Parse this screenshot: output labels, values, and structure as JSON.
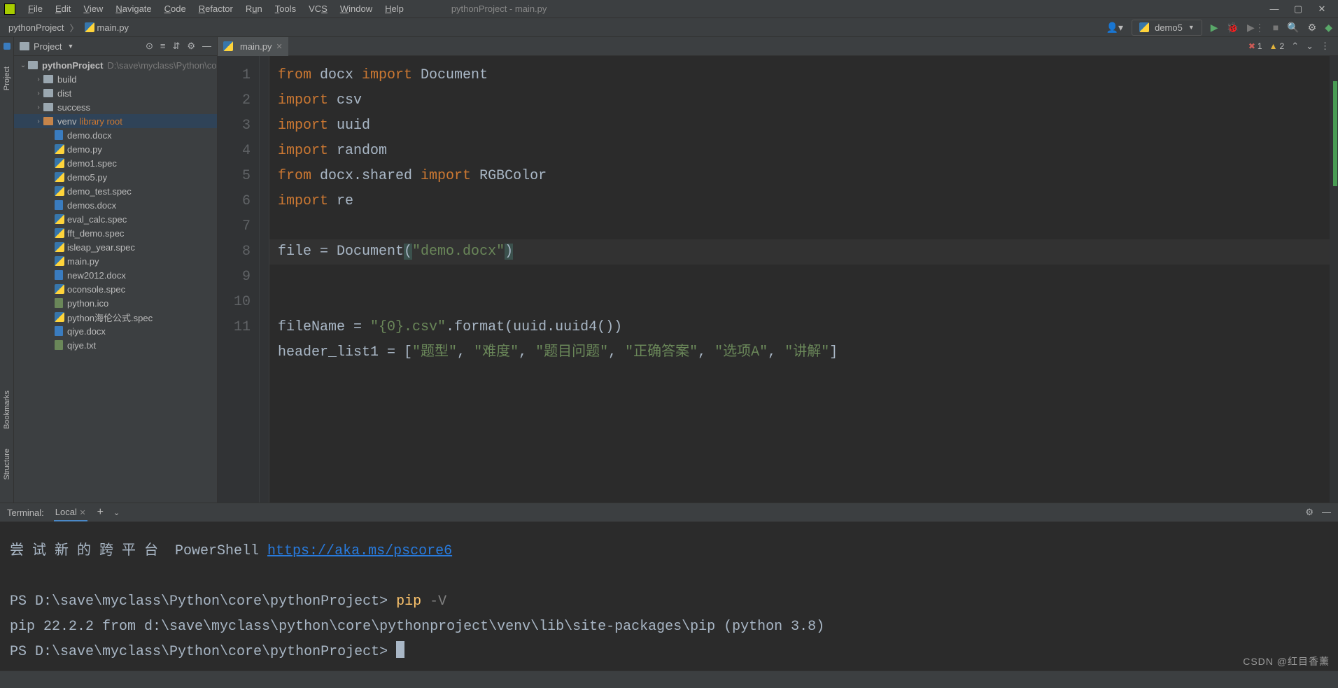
{
  "window": {
    "title": "pythonProject - main.py"
  },
  "menu": [
    "File",
    "Edit",
    "View",
    "Navigate",
    "Code",
    "Refactor",
    "Run",
    "Tools",
    "VCS",
    "Window",
    "Help"
  ],
  "breadcrumbs": {
    "project": "pythonProject",
    "file": "main.py"
  },
  "run_config": {
    "name": "demo5"
  },
  "inspection": {
    "errors": "1",
    "warnings": "2"
  },
  "project_panel": {
    "title": "Project"
  },
  "tree": {
    "root": {
      "name": "pythonProject",
      "path": "D:\\save\\myclass\\Python\\co"
    },
    "folders": [
      {
        "name": "build"
      },
      {
        "name": "dist"
      },
      {
        "name": "success"
      },
      {
        "name": "venv",
        "tag": "library root"
      }
    ],
    "files": [
      "demo.docx",
      "demo.py",
      "demo1.spec",
      "demo5.py",
      "demo_test.spec",
      "demos.docx",
      "eval_calc.spec",
      "fft_demo.spec",
      "isleap_year.spec",
      "main.py",
      "new2012.docx",
      "oconsole.spec",
      "python.ico",
      "python海伦公式.spec",
      "qiye.docx",
      "qiye.txt"
    ]
  },
  "tab": {
    "name": "main.py"
  },
  "code": {
    "lines": [
      {
        "n": "1",
        "k1": "from",
        "t1": " docx ",
        "k2": "import",
        "t2": " Document"
      },
      {
        "n": "2",
        "k1": "import",
        "t1": " csv"
      },
      {
        "n": "3",
        "k1": "import",
        "t1": " uuid"
      },
      {
        "n": "4",
        "k1": "import",
        "t1": " random"
      },
      {
        "n": "5",
        "k1": "from",
        "t1": " docx.shared ",
        "k2": "import",
        "t2": " RGBColor"
      },
      {
        "n": "6",
        "k1": "import",
        "t1": " re"
      },
      {
        "n": "7"
      },
      {
        "n": "8",
        "raw": "file = Document(",
        "str": "\"demo.docx\"",
        "close": ")",
        "hl": true
      },
      {
        "n": "9"
      },
      {
        "n": "10",
        "raw": "fileName = ",
        "str": "\"{0}.csv\"",
        "rest": ".format(uuid.uuid4())"
      },
      {
        "n": "11",
        "raw": "header_list1 = [",
        "strs": [
          "\"题型\"",
          "\"难度\"",
          "\"题目问题\"",
          "\"正确答案\"",
          "\"选项A\"",
          "\"讲解\""
        ],
        "close": "]"
      }
    ]
  },
  "terminal": {
    "title": "Terminal:",
    "tab": "Local",
    "line1_pre": "尝 试 新 的 跨 平 台  PowerShell ",
    "line1_link": "https://aka.ms/pscore6",
    "prompt1": "PS D:\\save\\myclass\\Python\\core\\pythonProject> ",
    "cmd1": "pip",
    "arg1": " -V",
    "out1": "pip 22.2.2 from d:\\save\\myclass\\python\\core\\pythonproject\\venv\\lib\\site-packages\\pip (python 3.8)",
    "prompt2": "PS D:\\save\\myclass\\Python\\core\\pythonProject> "
  },
  "watermark": "CSDN @红目香薰"
}
